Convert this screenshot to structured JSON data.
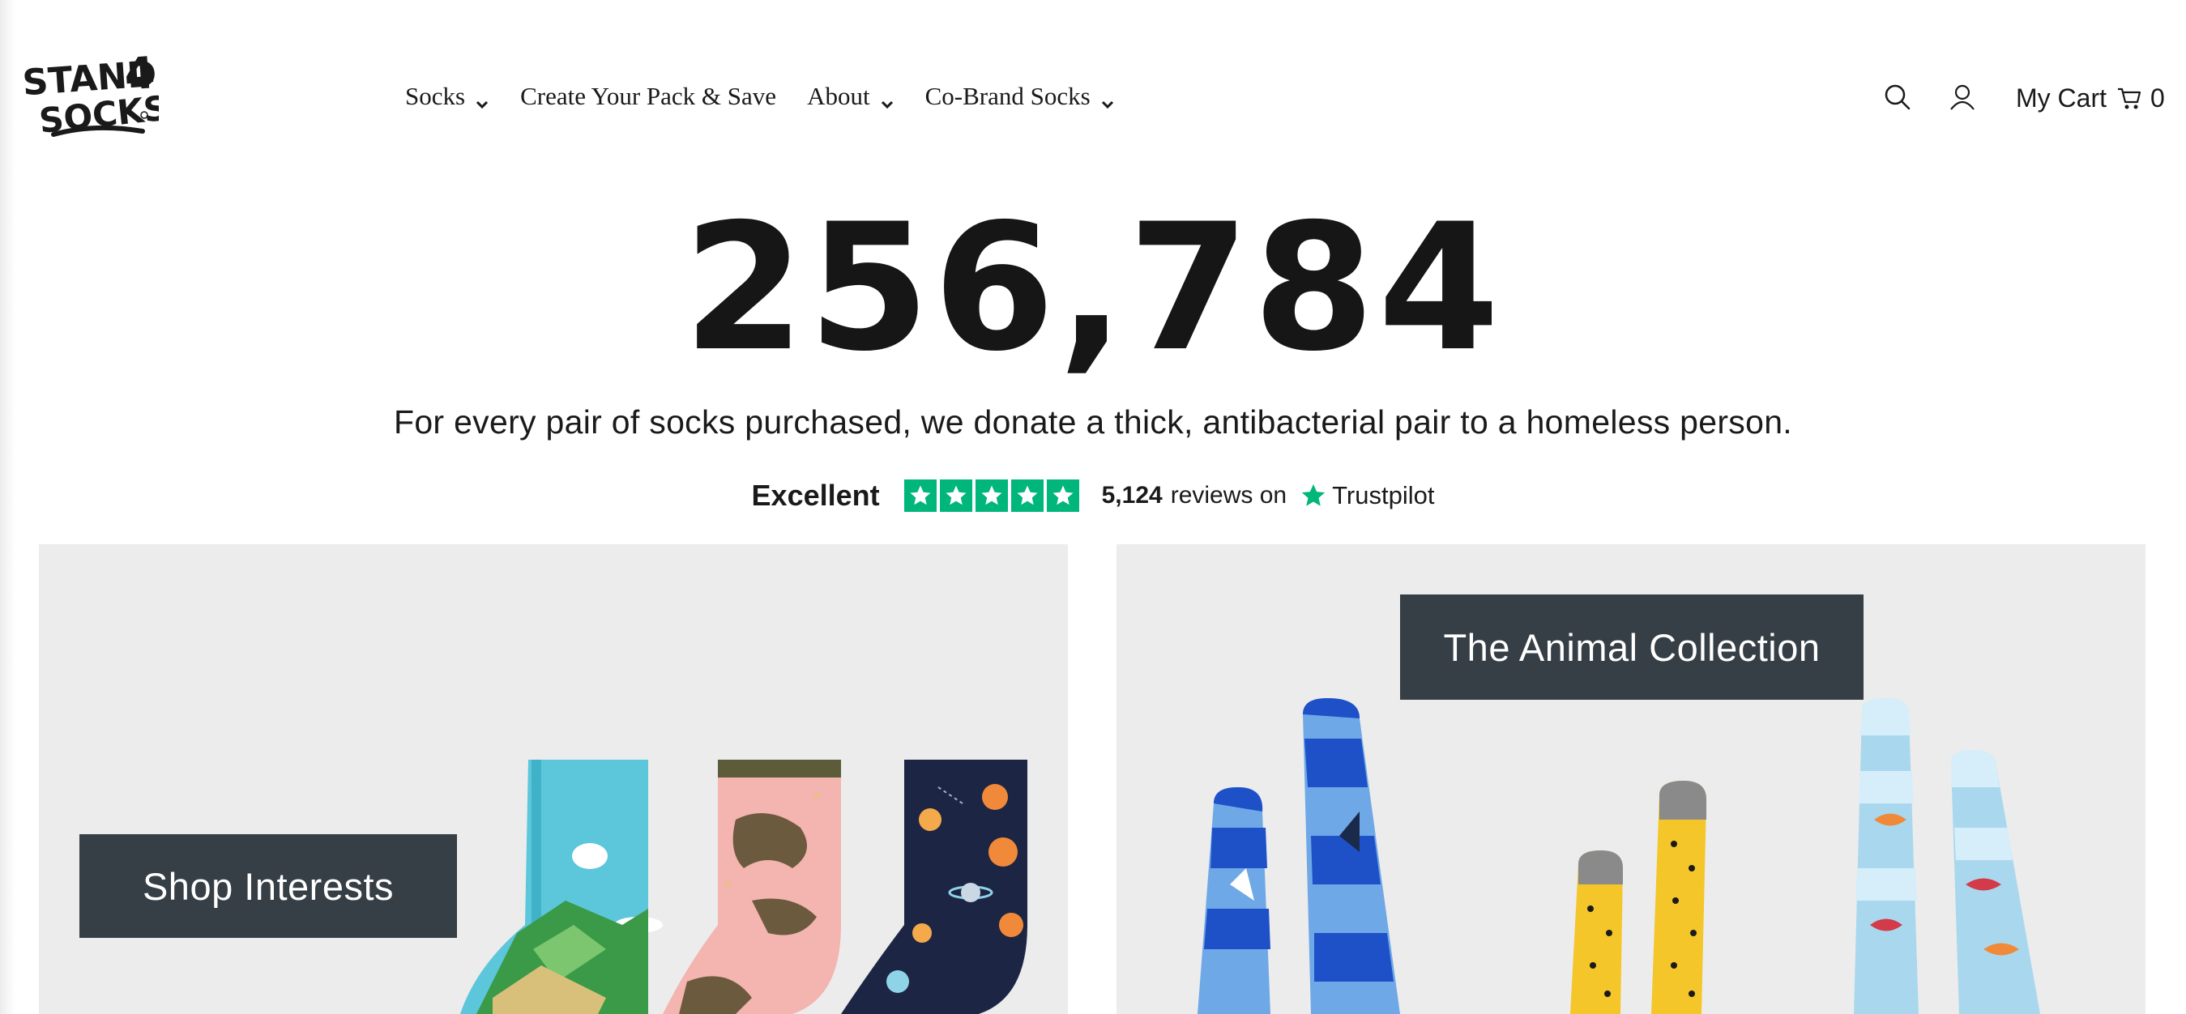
{
  "header": {
    "logo_text": "STAND4 SOCKS",
    "nav": [
      {
        "label": "Socks",
        "has_dropdown": true
      },
      {
        "label": "Create Your Pack & Save",
        "has_dropdown": false
      },
      {
        "label": "About",
        "has_dropdown": true
      },
      {
        "label": "Co-Brand Socks",
        "has_dropdown": true
      }
    ],
    "icons": {
      "search": "search-icon",
      "account": "user-icon",
      "cart": "cart-icon"
    },
    "cart_label": "My Cart",
    "cart_count": "0"
  },
  "hero": {
    "counter": "256,784",
    "mission": "For every pair of socks purchased, we donate a thick, antibacterial pair to a homeless person."
  },
  "trustpilot": {
    "rating_word": "Excellent",
    "stars": 5,
    "review_count": "5,124",
    "reviews_on": "reviews on",
    "brand": "Trustpilot",
    "star_color": "#00b67a"
  },
  "panels": [
    {
      "label": "Shop Interests"
    },
    {
      "label": "The Animal Collection"
    }
  ],
  "colors": {
    "panel_bg": "#ececec",
    "label_bg": "#363f45",
    "text": "#161616"
  }
}
